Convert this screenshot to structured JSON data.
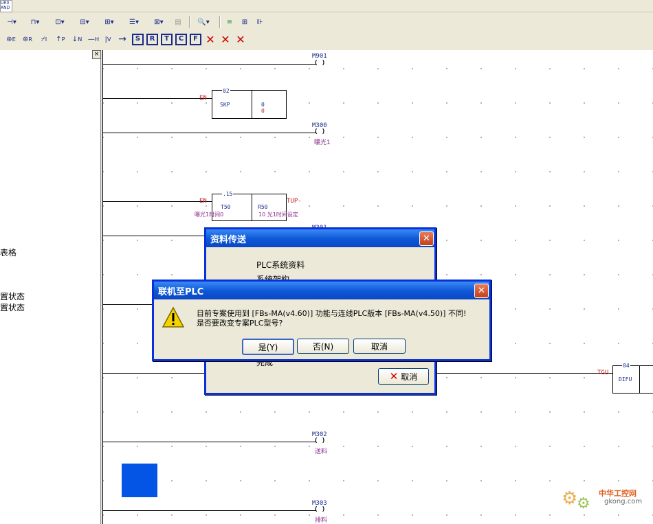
{
  "toolbar": {
    "corner_top": "UR0",
    "corner_bottom": "AND",
    "row2_letters": [
      "S",
      "R",
      "T",
      "C",
      "F"
    ],
    "row2_subs": [
      "E",
      "R",
      "I",
      "P",
      "N",
      "H",
      "V"
    ]
  },
  "left_panel": {
    "close_label": "×",
    "items": [
      "表格",
      "置状态",
      "置状态"
    ]
  },
  "ladder": {
    "coils": [
      {
        "name": "M901",
        "comment": ""
      },
      {
        "name": "M300",
        "comment": "曝光1"
      },
      {
        "name": "M302",
        "comment": "送料"
      },
      {
        "name": "M303",
        "comment": "排料"
      }
    ],
    "coil_symbol": "( )",
    "skp": {
      "num": "02",
      "label": "SKP",
      "val1": "0",
      "val2": "0",
      "en": "EN"
    },
    "timer": {
      "num": ".15",
      "en": "EN",
      "tup": "TUP-",
      "t_reg": "T50",
      "r_reg": "R50",
      "cmt_left": "曝光1时间0",
      "cmt_right": "10 光1时间设定"
    },
    "hidden_label": "M301",
    "difu": {
      "num": "04",
      "label": "DIFU",
      "pin": "TGU"
    }
  },
  "dialog_transfer": {
    "title": "资料传送",
    "line1": "PLC系统资料",
    "line2": "系统架构",
    "line3": "完成",
    "cancel_label": "取消"
  },
  "dialog_confirm": {
    "title": "联机至PLC",
    "message_line1": "目前专案使用到 [FBs-MA(v4.60)] 功能与连线PLC版本 [FBs-MA(v4.50)] 不同!",
    "message_line2": "是否要改变专案PLC型号?",
    "yes_label": "是(Y)",
    "no_label": "否(N)",
    "cancel_label": "取消"
  },
  "watermark": {
    "brand": "中华工控网",
    "url": "gkong.com"
  },
  "colors": {
    "accent": "#0455e6",
    "title_bar": "#0a46c4"
  }
}
